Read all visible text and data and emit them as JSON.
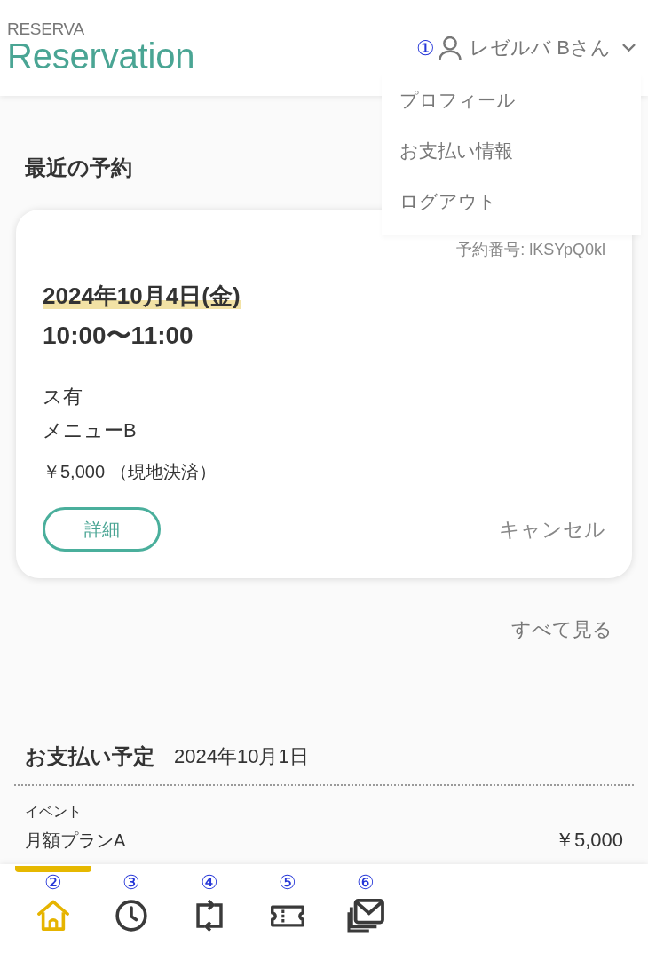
{
  "header": {
    "logo_small": "RESERVA",
    "logo": "Reservation",
    "user_menu": {
      "marker": "①",
      "name": "レゼルバ Bさん",
      "expanded": true,
      "items": [
        {
          "label": "プロフィール"
        },
        {
          "label": "お支払い情報"
        },
        {
          "label": "ログアウト"
        }
      ]
    }
  },
  "recent_reservations": {
    "title": "最近の予約",
    "cards": [
      {
        "reservation_number": "予約番号: lKSYpQ0kl",
        "date": "2024年10月4日(金)",
        "time": "10:00〜11:00",
        "details": [
          "ス有",
          "メニューB"
        ],
        "price": "￥5,000 （現地決済）",
        "detail_button": "詳細",
        "cancel_link": "キャンセル"
      }
    ],
    "view_all": "すべて見る"
  },
  "payment_schedule": {
    "title": "お支払い予定",
    "date": "2024年10月1日",
    "items": [
      {
        "category": "イベント",
        "name": "月額プランA",
        "amount": "￥5,000"
      }
    ]
  },
  "bottom_nav": [
    {
      "marker": "②",
      "selected": true
    },
    {
      "marker": "③",
      "selected": false
    },
    {
      "marker": "④",
      "selected": false
    },
    {
      "marker": "⑤",
      "selected": false
    },
    {
      "marker": "⑥",
      "selected": false
    }
  ]
}
